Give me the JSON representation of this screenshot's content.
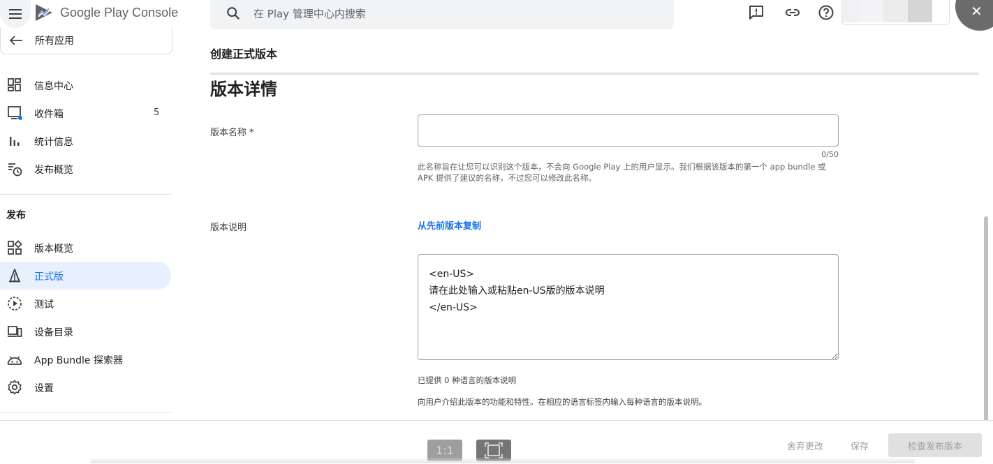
{
  "app": {
    "logo_text": "Google Play Console"
  },
  "search": {
    "placeholder": "在 Play 管理中心内搜索"
  },
  "sidebar": {
    "back_label": "所有应用",
    "items": [
      {
        "label": "信息中心",
        "icon": "dashboard-icon"
      },
      {
        "label": "收件箱",
        "icon": "inbox-icon",
        "badge": "5"
      },
      {
        "label": "统计信息",
        "icon": "bar-chart-icon"
      },
      {
        "label": "发布概览",
        "icon": "publishing-overview-icon"
      }
    ],
    "section_title": "发布",
    "release_items": [
      {
        "label": "版本概览",
        "icon": "releases-overview-icon"
      },
      {
        "label": "正式版",
        "icon": "production-icon",
        "active": true
      },
      {
        "label": "测试",
        "icon": "testing-icon"
      },
      {
        "label": "设备目录",
        "icon": "device-catalog-icon"
      },
      {
        "label": "App Bundle 探索器",
        "icon": "android-icon"
      },
      {
        "label": "设置",
        "icon": "settings-icon"
      }
    ]
  },
  "main": {
    "page_title": "创建正式版本",
    "section_heading": "版本详情",
    "release_name": {
      "label": "版本名称 *",
      "value": "",
      "counter": "0/50",
      "helper": "此名称旨在让您可以识别这个版本，不会向 Google Play 上的用户显示。我们根据该版本的第一个 app bundle 或 APK 提供了建议的名称，不过您可以修改此名称。"
    },
    "release_notes": {
      "label": "版本说明",
      "copy_link": "从先前版本复制",
      "value": "<en-US>\n请在此处输入或粘贴en-US版的版本说明\n</en-US>",
      "count_text": "已提供 0 种语言的版本说明",
      "hint": "向用户介绍此版本的功能和特性。在相应的语言标签内输入每种语言的版本说明。"
    }
  },
  "bottombar": {
    "zoom_label": "1:1",
    "discard_label": "舍弃更改",
    "save_label": "保存",
    "review_label": "检查发布版本"
  },
  "colors": {
    "accent": "#1a73e8",
    "active_bg": "#e8f0fe",
    "notification_dot": "#1a73e8"
  }
}
